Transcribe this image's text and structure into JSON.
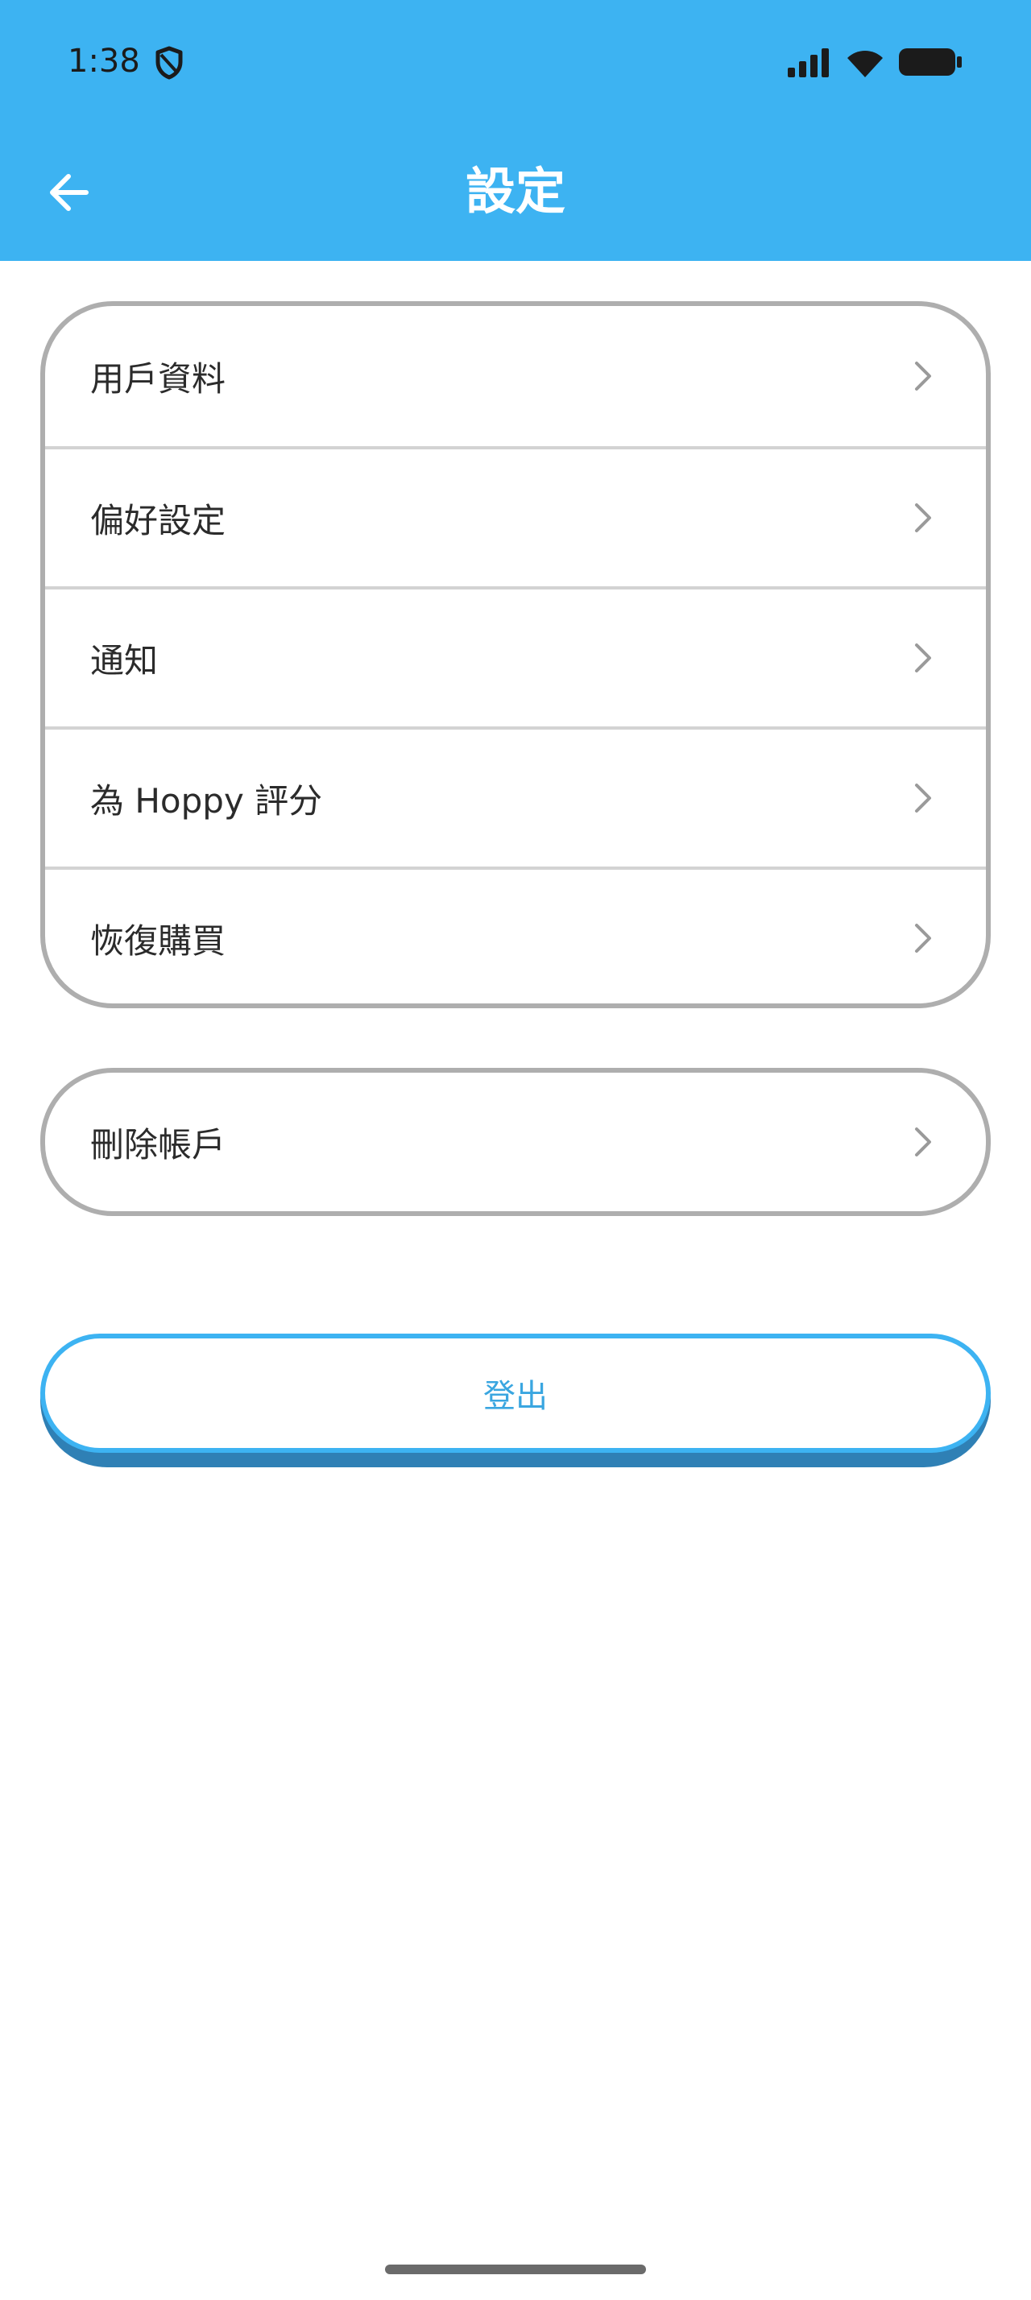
{
  "status_bar": {
    "time": "1:38",
    "icons": [
      "shield-icon",
      "cellular-signal-icon",
      "wifi-icon",
      "battery-icon"
    ]
  },
  "header": {
    "title": "設定",
    "back_icon": "arrow-left-icon",
    "background_color": "#3db3f2"
  },
  "settings_menu": {
    "items": [
      {
        "label": "用戶資料",
        "icon": "chevron-right-icon"
      },
      {
        "label": "偏好設定",
        "icon": "chevron-right-icon"
      },
      {
        "label": "通知",
        "icon": "chevron-right-icon"
      },
      {
        "label": "為 Hoppy 評分",
        "icon": "chevron-right-icon"
      },
      {
        "label": "恢復購買",
        "icon": "chevron-right-icon"
      }
    ]
  },
  "account_menu": {
    "items": [
      {
        "label": "刪除帳戶",
        "icon": "chevron-right-icon"
      }
    ]
  },
  "logout_button": {
    "label": "登出",
    "color": "#3db3f2"
  }
}
